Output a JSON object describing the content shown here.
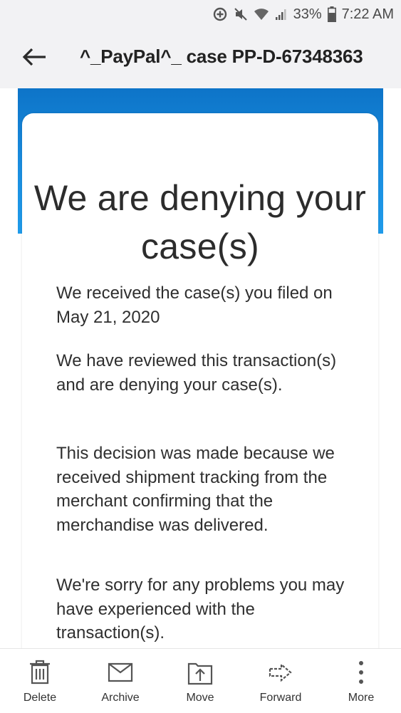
{
  "status_bar": {
    "battery_percent": "33%",
    "time": "7:22 AM"
  },
  "header": {
    "subject": "^_PayPal^_ case PP-D-67348363"
  },
  "email": {
    "title": "We are denying your case(s)",
    "paragraphs": [
      "We received the case(s) you filed on May 21, 2020",
      "We have reviewed this transaction(s) and are denying your case(s).",
      "This decision was made because we received shipment tracking from the merchant confirming that the merchandise was delivered.",
      "We're sorry for any problems you may have experienced with the transaction(s)."
    ],
    "colors": {
      "banner": "#1a8ee0"
    }
  },
  "actions": {
    "delete": "Delete",
    "archive": "Archive",
    "move": "Move",
    "forward": "Forward",
    "more": "More"
  }
}
